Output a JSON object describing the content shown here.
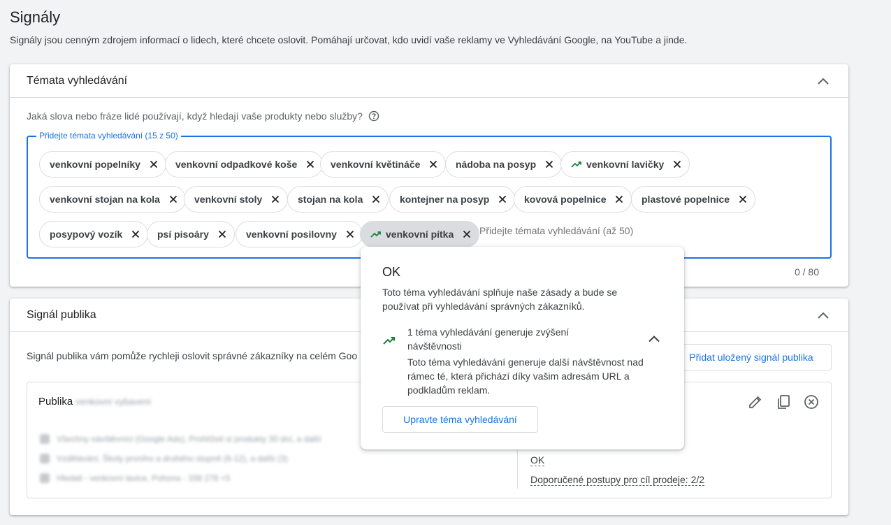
{
  "page": {
    "title": "Signály",
    "description": "Signály jsou cenným zdrojem informací o lidech, které chcete oslovit. Pomáhají určovat, kdo uvidí vaše reklamy ve Vyhledávání Google, na YouTube a jinde."
  },
  "search_themes": {
    "title": "Témata vyhledávání",
    "question": "Jaká slova nebo fráze lidé používají, když hledají vaše produkty nebo služby?",
    "field_label": "Přidejte témata vyhledávání (15 z 50)",
    "input_placeholder": "Přidejte témata vyhledávání (až 50)",
    "counter": "0 / 80",
    "chips": [
      {
        "label": "venkovní popelníky",
        "trending": false
      },
      {
        "label": "venkovní odpadkové koše",
        "trending": false
      },
      {
        "label": "venkovní květináče",
        "trending": false
      },
      {
        "label": "nádoba na posyp",
        "trending": false
      },
      {
        "label": "venkovní lavičky",
        "trending": true
      },
      {
        "label": "venkovní stojan na kola",
        "trending": false
      },
      {
        "label": "venkovní stoly",
        "trending": false
      },
      {
        "label": "stojan na kola",
        "trending": false
      },
      {
        "label": "kontejner na posyp",
        "trending": false
      },
      {
        "label": "kovová popelnice",
        "trending": false
      },
      {
        "label": "plastové popelnice",
        "trending": false
      },
      {
        "label": "posypový vozík",
        "trending": false
      },
      {
        "label": "psí pisoáry",
        "trending": false
      },
      {
        "label": "venkovní posilovny",
        "trending": false
      },
      {
        "label": "venkovní pítka",
        "trending": true,
        "active": true
      }
    ]
  },
  "audience_signal": {
    "title": "Signál publika",
    "description": "Signál publika vám pomůže rychleji oslovit správné zákazníky na celém Goo",
    "saved_button": "Přidat uložený signál publika",
    "audience_label": "Publika",
    "audience_name_blurred": "venkovní vybavení",
    "blurred_rows": [
      "Všechny návštěvníci (Google Ads), Prohlíželi si produkty 30 dní, a další",
      "Vzdělávání, Školy prvního a druhého stupně (6-12), a další (3)",
      "Hledali - venkovní lavice, Pohona - 338 278 +5"
    ],
    "status_ok": "OK",
    "recommendation": "Doporučené postupy pro cíl prodeje: 2/2"
  },
  "popup": {
    "title": "OK",
    "text": "Toto téma vyhledávání splňuje naše zásady a bude se používat při vyhledávání správných zákazníků.",
    "sub_title": "1 téma vyhledávání generuje zvýšení návštěvnosti",
    "sub_text": "Toto téma vyhledávání generuje další návštěvnost nad rámec té, která přichází díky vašim adresám URL a podkladům reklam.",
    "button": "Upravte téma vyhledávání"
  },
  "colors": {
    "accent": "#1a73e8",
    "trend_green": "#188038",
    "chip_active": "#dadce0"
  }
}
